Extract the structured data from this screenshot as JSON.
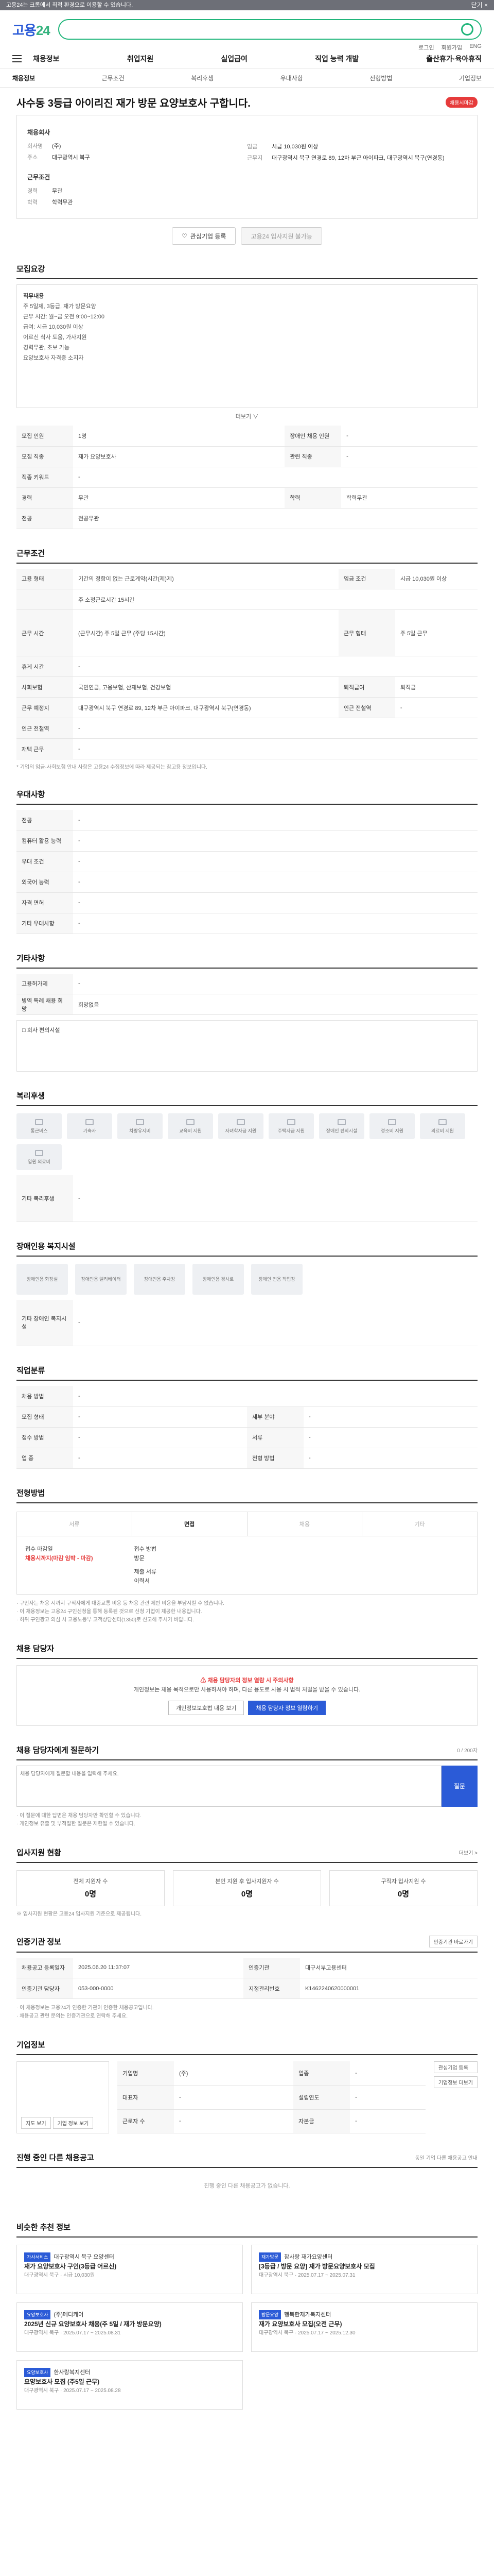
{
  "topbar": {
    "text": "고용24는 크롬에서 최적 환경으로 이용할 수 있습니다.",
    "close": "닫기 ×"
  },
  "brand": {
    "logo_a": "고용",
    "logo_b": "24"
  },
  "util": [
    "로그인",
    "회원가입",
    "ENG"
  ],
  "nav": [
    "채용정보",
    "취업지원",
    "실업급여",
    "직업 능력 개발",
    "출산휴가·육아휴직"
  ],
  "subnav": [
    "채용정보",
    "근무조건",
    "복리후생",
    "우대사항",
    "전형방법",
    "기업정보"
  ],
  "job": {
    "title": "사수동 3등급 아이리진 재가 방문 요양보호사 구합니다.",
    "badge": "채용시마감"
  },
  "company": {
    "header": "채용회사",
    "name_k": "회사명",
    "name_v": "(주)",
    "addr_k": "주소",
    "addr_v": "대구광역시 북구",
    "head2": "근무조건",
    "career_k": "경력",
    "career_v": "무관",
    "edu_k": "학력",
    "edu_v": "학력무관",
    "pay_k": "임금",
    "pay_v": "시급 10,030원 이상",
    "loc_k": "근무지",
    "loc_v": "대구광역시 북구 연경로 89, 12차 부근 아이파크, 대구광역시 북구(연경동)"
  },
  "btns": {
    "interest": "관심기업 등록",
    "apply": "고용24 입사지원 불가능"
  },
  "s1": {
    "title": "모집요강",
    "body": [
      "직무내용",
      "주 5일제, 3등급, 재가 방문요양",
      "근무 시간: 월~금 오전 9:00~12:00",
      "급여: 시급 10,030원 이상",
      "어르신 식사 도움, 가사지원",
      "경력무관, 초보 가능",
      "요양보호사 자격증 소지자"
    ],
    "more": "더보기 ∨"
  },
  "s1t": [
    [
      "모집 인원",
      "1명",
      "장애인 채용 인원",
      "-"
    ],
    [
      "모집 직종",
      "재가 요양보호사",
      "관련 직종",
      "-"
    ],
    [
      "직종 키워드",
      "-",
      "",
      ""
    ],
    [
      "경력",
      "무관",
      "학력",
      "학력무관"
    ],
    [
      "전공",
      "전공무관",
      "",
      ""
    ]
  ],
  "s2": {
    "title": "근무조건"
  },
  "s2t": [
    [
      "고용 형태",
      "기간의 정함이 없는 근로계약(시간(제)제)",
      "임금 조건",
      "시급 10,030원 이상"
    ],
    [
      "",
      "주 소정근로시간 15시간",
      "",
      ""
    ],
    [
      "근무 시간",
      "(근무시간) 주 5일 근무 (주당 15시간)",
      "근무 형태",
      "주 5일 근무"
    ],
    [
      "휴게 시간",
      "-",
      "",
      ""
    ],
    [
      "사회보험",
      "국민연금, 고용보험, 산재보험, 건강보험",
      "퇴직급여",
      "퇴직금"
    ],
    [
      "근무 예정지",
      "대구광역시 북구 연경로 89, 12차 부근 아이파크, 대구광역시 북구(연경동)",
      "인근 전철역",
      "-"
    ],
    [
      "인근 전철역",
      "-",
      "",
      ""
    ],
    [
      "재택 근무",
      "-",
      "",
      ""
    ]
  ],
  "s2note": "* 기업의 임금·사회보험 안내 사항은 고용24 수집정보에 따라 제공되는 참고용 정보입니다.",
  "s3": {
    "title": "우대사항"
  },
  "s3t": [
    [
      "전공",
      "-"
    ],
    [
      "컴퓨터 활용 능력",
      "-"
    ],
    [
      "우대 조건",
      "-"
    ],
    [
      "외국어 능력",
      "-"
    ],
    [
      "자격 면허",
      "-"
    ],
    [
      "기타 우대사항",
      "-"
    ]
  ],
  "s4": {
    "title": "기타사항"
  },
  "s4t": [
    [
      "고용허가제",
      "-"
    ],
    [
      "병역 특례 채용 희망",
      "희망없음"
    ]
  ],
  "s4sub": "□ 회사 편의시설",
  "s5": {
    "title": "복리후생",
    "items": [
      "통근버스",
      "기숙사",
      "차량유지비",
      "교육비 지원",
      "자녀학자금 지원",
      "주택자금 지원",
      "장애인 편의시설",
      "경조비 지원",
      "의료비 지원",
      "입원 의료비"
    ],
    "extra_k": "기타 복리후생",
    "extra_v": "-"
  },
  "s6": {
    "title": "장애인용 복지시설",
    "items": [
      "장애인용 화장실",
      "장애인용 엘리베이터",
      "장애인용 주차장",
      "장애인용 경사로",
      "장애인 전용 작업장"
    ],
    "extra_k": "기타 장애인 복지시설",
    "extra_v": "-"
  },
  "s7": {
    "title": "직업분류"
  },
  "s7t": [
    [
      "채용 방법",
      "-",
      "",
      ""
    ],
    [
      "모집 형태",
      "-",
      "세부 분야",
      "-"
    ],
    [
      "접수 방법",
      "-",
      "서류",
      "-"
    ],
    [
      "업 종",
      "-",
      "전형 방법",
      "-"
    ]
  ],
  "s8": {
    "title": "전형방법",
    "steps": [
      "서류",
      "면접",
      "채용",
      "기타"
    ],
    "info1_k": "접수 마감일",
    "info1_v": "채용시까지(마감 임박 - 마감)",
    "info2_k": "접수 방법",
    "info2_v": "방문",
    "info3_k": "제출 서류",
    "info3_v": "이력서"
  },
  "notice": [
    "· 구인자는 채용 시까지 구직자에게 대중교통 비용 등 채용 관련 제반 비용을 부담시킬 수 없습니다.",
    "· 이 채용정보는 고용24 구인신청을 통해 등록된 것으로 신청 기업이 제공한 내용입니다.",
    "· 허위 구인광고 의심 시 고용노동부 고객상담센터(1350)로 신고해 주시기 바랍니다."
  ],
  "s9": {
    "title": "채용 담당자",
    "line1": "채용 담당자의 정보 열람 시 주의사항",
    "line2": "개인정보는 채용 목적으로만 사용하셔야 하며, 다른 용도로 사용 시 법적 처벌을 받을 수 있습니다.",
    "btn1": "개인정보보호법 내용 보기",
    "btn2": "채용 담당자 정보 열람하기"
  },
  "s10": {
    "title": "채용 담당자에게 질문하기",
    "hint": "0 / 200자",
    "placeholder": "채용 담당자에게 질문할 내용을 입력해 주세요.",
    "btn": "질문",
    "notes": [
      "· 이 질문에 대한 답변은 채용 담당자만 확인할 수 있습니다.",
      "· 개인정보 유출 및 부적절한 질문은 제한될 수 있습니다."
    ]
  },
  "s11": {
    "title": "입사지원 현황",
    "more": "더보기 >",
    "stats": [
      [
        "전체 지원자 수",
        "0명"
      ],
      [
        "본인 지원 후 입사지원자 수",
        "0명"
      ],
      [
        "구직자 입사지원 수",
        "0명"
      ]
    ],
    "note": "※ 입사지원 현황은 고용24 입사지원 기준으로 제공됩니다."
  },
  "s12": {
    "title": "인증기관 정보",
    "btn": "인증기관 바로가기",
    "rows": [
      [
        "채용공고 등록일자",
        "2025.06.20 11:37:07",
        "인증기관",
        "대구서부고용센터"
      ],
      [
        "인증기관 담당자",
        "053-000-0000",
        "지정관리번호",
        "K1462240620000001"
      ]
    ],
    "notes": [
      "· 이 채용정보는 고용24가 인증한 기관이 인증한 채용공고입니다.",
      "· 채용공고 관련 문의는 인증기관으로 연락해 주세요."
    ]
  },
  "s13": {
    "title": "기업정보",
    "rows": [
      [
        "기업명",
        "(주)",
        "업종",
        "-"
      ],
      [
        "대표자",
        "-",
        "설립연도",
        "-"
      ],
      [
        "근로자 수",
        "-",
        "자본금",
        "-"
      ],
      [
        "주소",
        "대구광역시 북구",
        "홈페이지",
        "-"
      ]
    ],
    "btn1": "관심기업 등록",
    "btn2": "기업정보 더보기",
    "chip1": "지도 보기",
    "chip2": "기업 정보 보기"
  },
  "s14": {
    "title": "진행 중인 다른 채용공고",
    "empty": "진행 중인 다른 채용공고가 없습니다.",
    "note": "동일 기업 다른 채용공고 안내"
  },
  "s15": {
    "title": "비슷한 추천 정보",
    "cards": [
      {
        "tag": "가사서비스",
        "org": "대구광역시 북구 요양센터",
        "ttl": "재가 요양보호사 구인(3등급 어르신)",
        "sub": "대구광역시 북구 · 시급 10,030원"
      },
      {
        "tag": "재가방문",
        "org": "참사랑 재가요양센터",
        "ttl": "[3등급 / 방문 요양] 재가 방문요양보호사 모집",
        "sub": "대구광역시 북구 · 2025.07.17 ~ 2025.07.31"
      },
      {
        "tag": "요양보호사",
        "org": "(주)메디케어",
        "ttl": "2025년 신규 요양보호사 채용(주 5일 / 재가 방문요양)",
        "sub": "대구광역시 북구 · 2025.07.17 ~ 2025.08.31"
      },
      {
        "tag": "방문요양",
        "org": "행복한재가복지센터",
        "ttl": "재가 요양보호사 모집(오전 근무)",
        "sub": "대구광역시 북구 · 2025.07.17 ~ 2025.12.30"
      },
      {
        "tag": "요양보호사",
        "org": "한사랑복지센터",
        "ttl": "요양보호사 모집 (주5일 근무)",
        "sub": "대구광역시 북구 · 2025.07.17 ~ 2025.08.28"
      }
    ]
  }
}
